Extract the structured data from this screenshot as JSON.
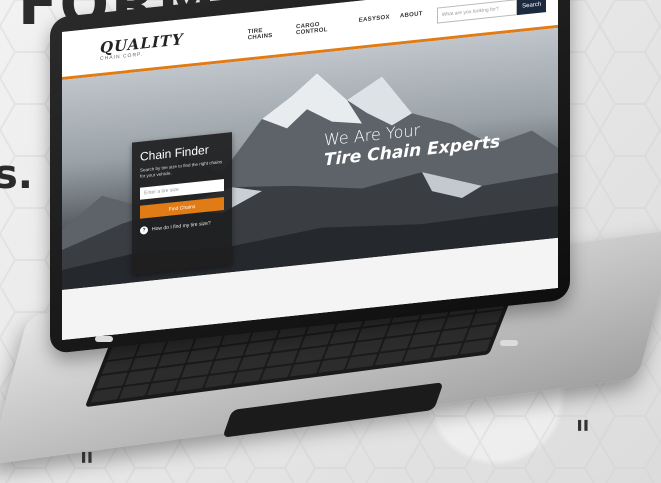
{
  "page": {
    "heading_fragment": "FORMATION.",
    "side_fragment": "s."
  },
  "site": {
    "logo": {
      "word": "QUALITY",
      "sub": "CHAIN CORP."
    },
    "nav": [
      "TIRE CHAINS",
      "CARGO CONTROL",
      "EASYSOX",
      "ABOUT"
    ],
    "search": {
      "placeholder": "What are you looking for?",
      "button": "Search"
    },
    "hero": {
      "line1": "We Are Your",
      "line2": "Tire Chain Experts"
    },
    "finder": {
      "title": "Chain Finder",
      "description": "Search by tire size to find the right chains for your vehicle.",
      "input_placeholder": "Enter a tire size",
      "button": "Find Chains",
      "help": "How do I find my tire size?"
    }
  },
  "colors": {
    "accent": "#e07b16",
    "dark_button": "#1c2a40",
    "finder_bg": "#1e1e20"
  },
  "icons": [
    "question-icon"
  ]
}
